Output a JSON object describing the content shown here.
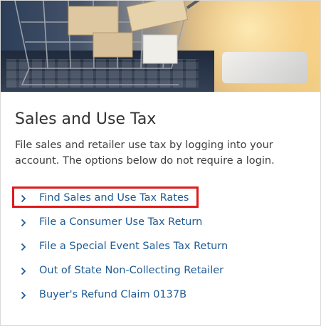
{
  "section": {
    "title": "Sales and Use Tax",
    "description": "File sales and retailer use tax by logging into your account. The options below do not require a login."
  },
  "links": [
    {
      "label": "Find Sales and Use Tax Rates",
      "highlighted": true
    },
    {
      "label": "File a Consumer Use Tax Return",
      "highlighted": false
    },
    {
      "label": "File a Special Event Sales Tax Return",
      "highlighted": false
    },
    {
      "label": "Out of State Non-Collecting Retailer",
      "highlighted": false
    },
    {
      "label": "Buyer's Refund Claim 0137B",
      "highlighted": false
    }
  ],
  "icons": {
    "link_chevron": "chevron-right-icon"
  },
  "colors": {
    "link": "#1f5a93",
    "highlight_border": "#e01a1a",
    "title": "#333333"
  }
}
